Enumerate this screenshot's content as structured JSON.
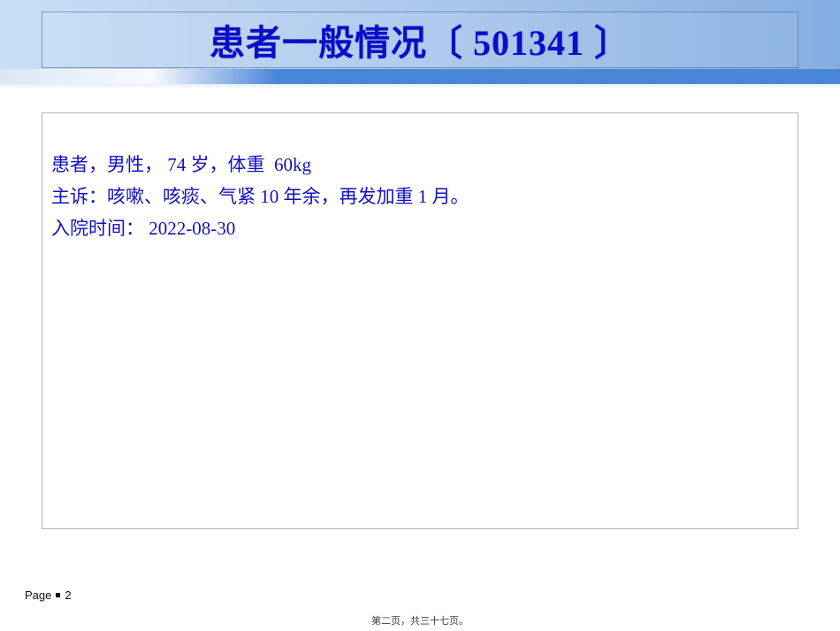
{
  "slide": {
    "title": "患者一般情况〔 501341 〕",
    "body_lines": [
      "患者，男性， 74 岁，体重  60kg",
      "主诉：咳嗽、咳痰、气紧 10 年余，再发加重 1 月。",
      "入院时间： 2022-08-30"
    ],
    "footer": {
      "page_label": "Page",
      "page_number": "2"
    },
    "page_note": "第二页，共三十七页。"
  },
  "colors": {
    "header_gradient_left": "#cadef5",
    "header_gradient_right": "#85aee0",
    "accent_band_blue": "#4a86d8",
    "accent_band_light": "#dbe7f5",
    "title_text": "#0d0dc8",
    "body_text": "#1212bf",
    "title_box_border": "#485e86",
    "content_box_border": "#b3b3b3",
    "footer_text": "#111111",
    "page_note_text": "#3d3d3d"
  }
}
